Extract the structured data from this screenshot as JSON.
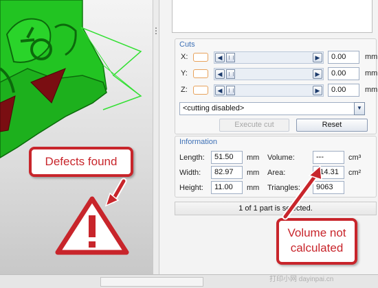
{
  "cuts": {
    "title": "Cuts",
    "axes": [
      {
        "label": "X:",
        "value": "0.00",
        "unit": "mm"
      },
      {
        "label": "Y:",
        "value": "0.00",
        "unit": "mm"
      },
      {
        "label": "Z:",
        "value": "0.00",
        "unit": "mm"
      }
    ],
    "selected_option": "<cutting disabled>",
    "execute_label": "Execute cut",
    "reset_label": "Reset"
  },
  "information": {
    "title": "Information",
    "length": {
      "label": "Length:",
      "value": "51.50",
      "unit": "mm"
    },
    "width": {
      "label": "Width:",
      "value": "82.97",
      "unit": "mm"
    },
    "height": {
      "label": "Height:",
      "value": "11.00",
      "unit": "mm"
    },
    "volume": {
      "label": "Volume:",
      "value": "---",
      "unit": "cm³"
    },
    "area": {
      "label": "Area:",
      "value": "114.31",
      "unit": "cm²"
    },
    "triangles": {
      "label": "Triangles:",
      "value": "9063"
    }
  },
  "status": "1 of 1 part is selected.",
  "callouts": {
    "defects": "Defects found",
    "volume_line1": "Volume not",
    "volume_line2": "calculated"
  },
  "watermark": "打印小网 dayinpai.cn",
  "colors": {
    "model_green": "#22c422",
    "defect_red": "#7a0e12",
    "callout_red": "#c8252b",
    "group_title_blue": "#3c6fb5"
  },
  "icons": [
    "warning-triangle-icon",
    "scroll-left-icon",
    "scroll-right-icon",
    "dropdown-chevron-icon"
  ]
}
